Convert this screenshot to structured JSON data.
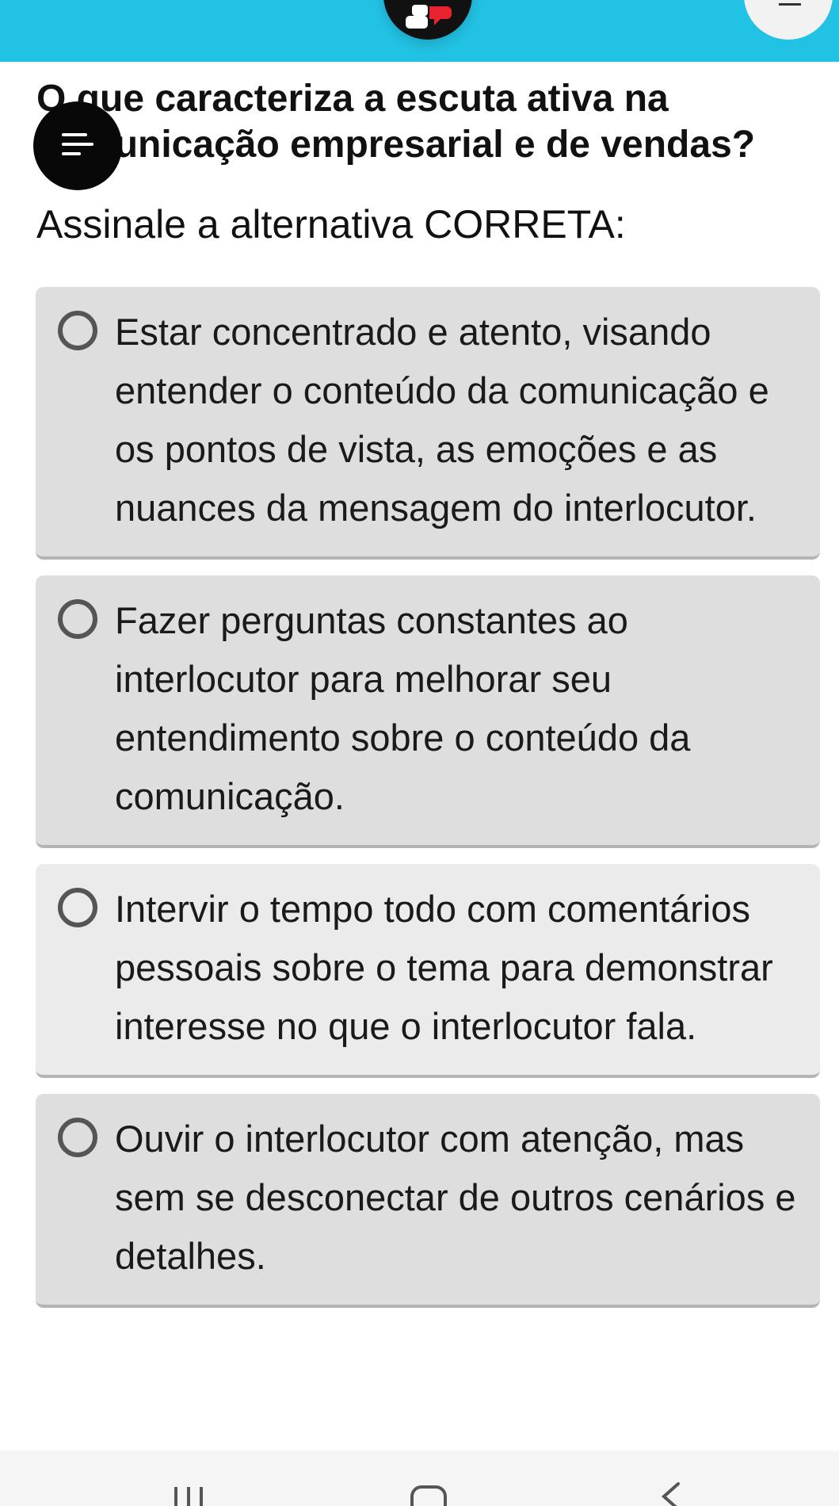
{
  "header": {
    "logo_icon": "chat-bubbles-logo-icon",
    "accent_color": "#22c2e4",
    "logo_red": "#e8222e",
    "right_button_icon": "minus-icon"
  },
  "question": {
    "title": "O que caracteriza a escuta ativa na comunicação empresarial e de vendas?",
    "instruction": "Assinale a alternativa CORRETA:"
  },
  "menu_button": {
    "icon": "menu-icon"
  },
  "options": [
    {
      "text": "Estar concentrado e atento, visando entender o conteúdo da comunicação e os pontos de vista, as emoções e as nuances da mensagem do interlocutor.",
      "selected": false
    },
    {
      "text": "Fazer perguntas constantes ao interlocutor para melhorar seu entendimento sobre o conteúdo da comunicação.",
      "selected": false
    },
    {
      "text": "Intervir o tempo todo com comentários pessoais sobre o tema para demonstrar interesse no que o interlocutor fala.",
      "selected": false
    },
    {
      "text": "Ouvir o interlocutor com atenção, mas sem se desconectar de outros cenários e detalhes.",
      "selected": false
    }
  ],
  "nav": {
    "recents_icon": "recents-icon",
    "home_icon": "home-icon",
    "back_icon": "back-icon"
  }
}
